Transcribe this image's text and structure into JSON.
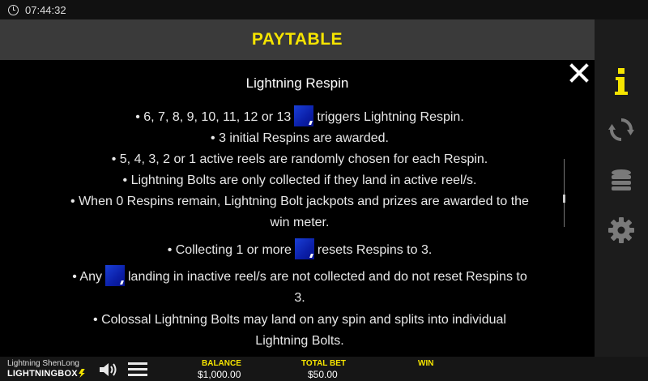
{
  "status": {
    "time": "07:44:32"
  },
  "header": {
    "title": "PAYTABLE"
  },
  "content": {
    "section_title": "Lightning Respin",
    "lines": [
      {
        "before": "• 6, 7, 8, 9, 10, 11, 12 or 13",
        "after": "triggers Lightning Respin."
      },
      {
        "text": "• 3 initial Respins are awarded."
      },
      {
        "text": "• 5, 4, 3, 2 or 1 active reels are randomly chosen for each Respin."
      },
      {
        "text": "• Lightning Bolts are only collected if they land in active reel/s."
      },
      {
        "text": "• When 0 Respins remain, Lightning Bolt jackpots and prizes are awarded to the"
      },
      {
        "text": "win meter."
      },
      {
        "before": "• Collecting 1 or more",
        "after": "resets Respins to 3."
      },
      {
        "before": "• Any",
        "after": "landing in inactive reel/s are not collected and do not reset Respins to"
      },
      {
        "text": "3."
      },
      {
        "text": "• Colossal Lightning Bolts may land on any spin and splits into individual"
      },
      {
        "text": "Lightning Bolts."
      }
    ]
  },
  "sidebar": {
    "items": [
      {
        "name": "info-icon",
        "active": true
      },
      {
        "name": "autoplay-icon",
        "active": false
      },
      {
        "name": "bet-coins-icon",
        "active": false
      },
      {
        "name": "settings-gear-icon",
        "active": false
      }
    ]
  },
  "bottom": {
    "game_name": "Lightning ShenLong",
    "brand": "LIGHTNING",
    "brand_box": "BOX",
    "balance_label": "BALANCE",
    "balance_value": "$1,000.00",
    "total_bet_label": "TOTAL BET",
    "total_bet_value": "$50.00",
    "win_label": "WIN",
    "win_value": ""
  },
  "colors": {
    "accent": "#f5e400",
    "header_bg": "#3a3a3a",
    "symbol_blue": "#1a3fd6"
  }
}
